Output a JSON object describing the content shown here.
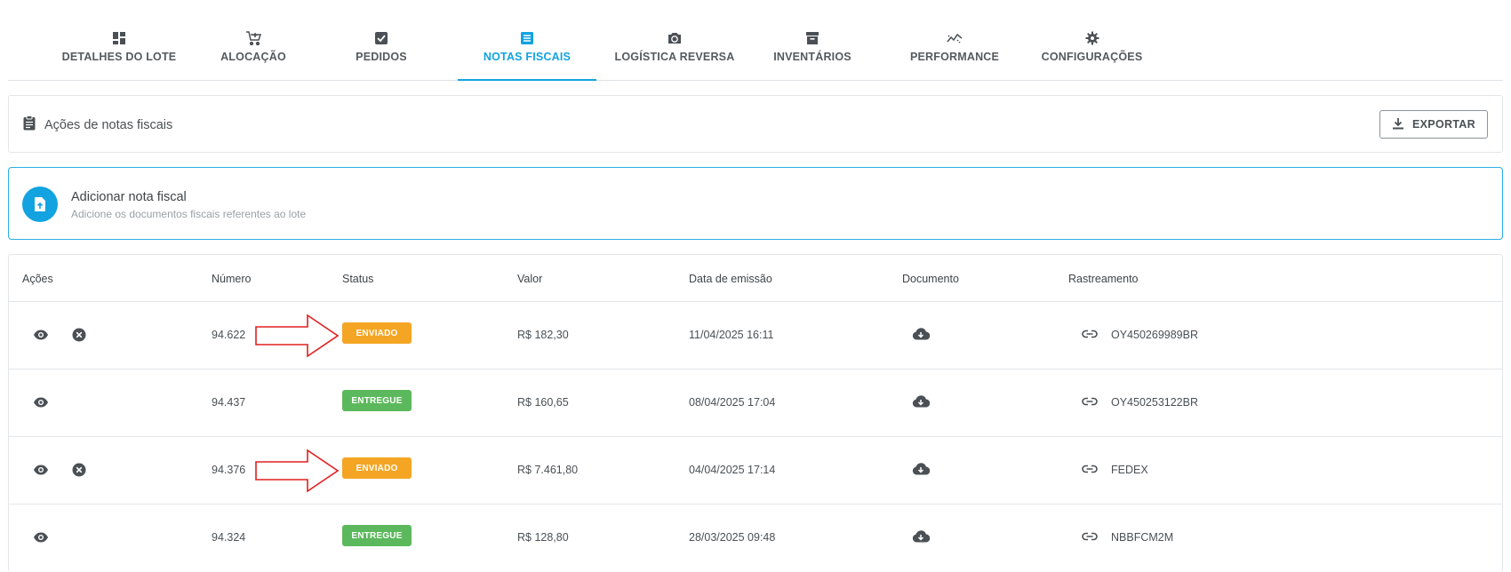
{
  "tabs": [
    {
      "label": "DETALHES DO LOTE",
      "icon": "dashboard-icon"
    },
    {
      "label": "ALOCAÇÃO",
      "icon": "cart-add-icon"
    },
    {
      "label": "PEDIDOS",
      "icon": "checkbox-icon"
    },
    {
      "label": "NOTAS FISCAIS",
      "icon": "document-list-icon",
      "active": true
    },
    {
      "label": "LOGÍSTICA REVERSA",
      "icon": "camera-rotate-icon"
    },
    {
      "label": "INVENTÁRIOS",
      "icon": "archive-icon"
    },
    {
      "label": "PERFORMANCE",
      "icon": "performance-icon"
    },
    {
      "label": "CONFIGURAÇÕES",
      "icon": "gear-icon"
    }
  ],
  "actions": {
    "title": "Ações de notas fiscais",
    "export_label": "EXPORTAR"
  },
  "add_invoice": {
    "title": "Adicionar nota fiscal",
    "subtitle": "Adicione os documentos fiscais referentes ao lote"
  },
  "table": {
    "headers": {
      "acoes": "Ações",
      "numero": "Número",
      "status": "Status",
      "valor": "Valor",
      "data": "Data de emissão",
      "documento": "Documento",
      "rastreamento": "Rastreamento"
    },
    "rows": [
      {
        "numero": "94.622",
        "status": "ENVIADO",
        "valor": "R$ 182,30",
        "data": "11/04/2025 16:11",
        "rastreamento": "OY450269989BR"
      },
      {
        "numero": "94.437",
        "status": "ENTREGUE",
        "valor": "R$ 160,65",
        "data": "08/04/2025 17:04",
        "rastreamento": "OY450253122BR"
      },
      {
        "numero": "94.376",
        "status": "ENVIADO",
        "valor": "R$ 7.461,80",
        "data": "04/04/2025 17:14",
        "rastreamento": "FEDEX"
      },
      {
        "numero": "94.324",
        "status": "ENTREGUE",
        "valor": "R$ 128,80",
        "data": "28/03/2025 09:48",
        "rastreamento": "NBBFCM2M"
      }
    ]
  },
  "colors": {
    "accent": "#12a3e0",
    "enviado": "#f5a524",
    "entregue": "#5cb85c",
    "annotation_arrow": "#e02020"
  }
}
